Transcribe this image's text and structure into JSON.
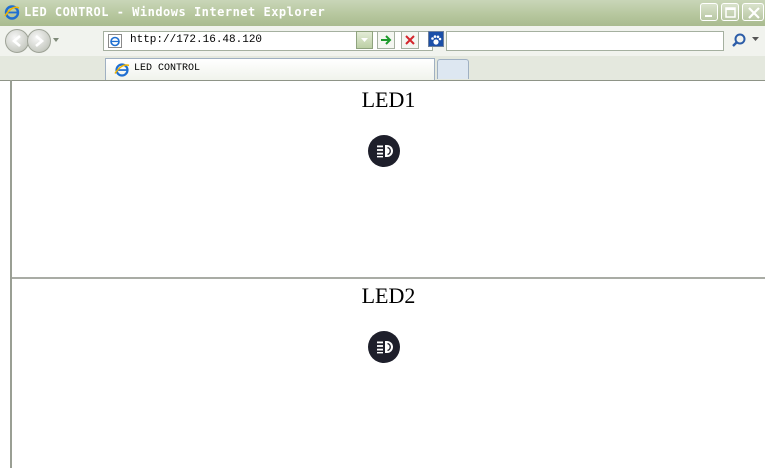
{
  "window": {
    "title": "LED CONTROL - Windows Internet Explorer"
  },
  "address_bar": {
    "url": "http://172.16.48.120"
  },
  "tabs": [
    {
      "label": "LED CONTROL",
      "active": true
    }
  ],
  "colors": {
    "title_bar": "#b7c79f",
    "led_button": "#1e1f2b",
    "led_icon": "#ffffff"
  },
  "panels": [
    {
      "title": "LED1",
      "icon": "headlight-icon"
    },
    {
      "title": "LED2",
      "icon": "headlight-icon"
    }
  ]
}
